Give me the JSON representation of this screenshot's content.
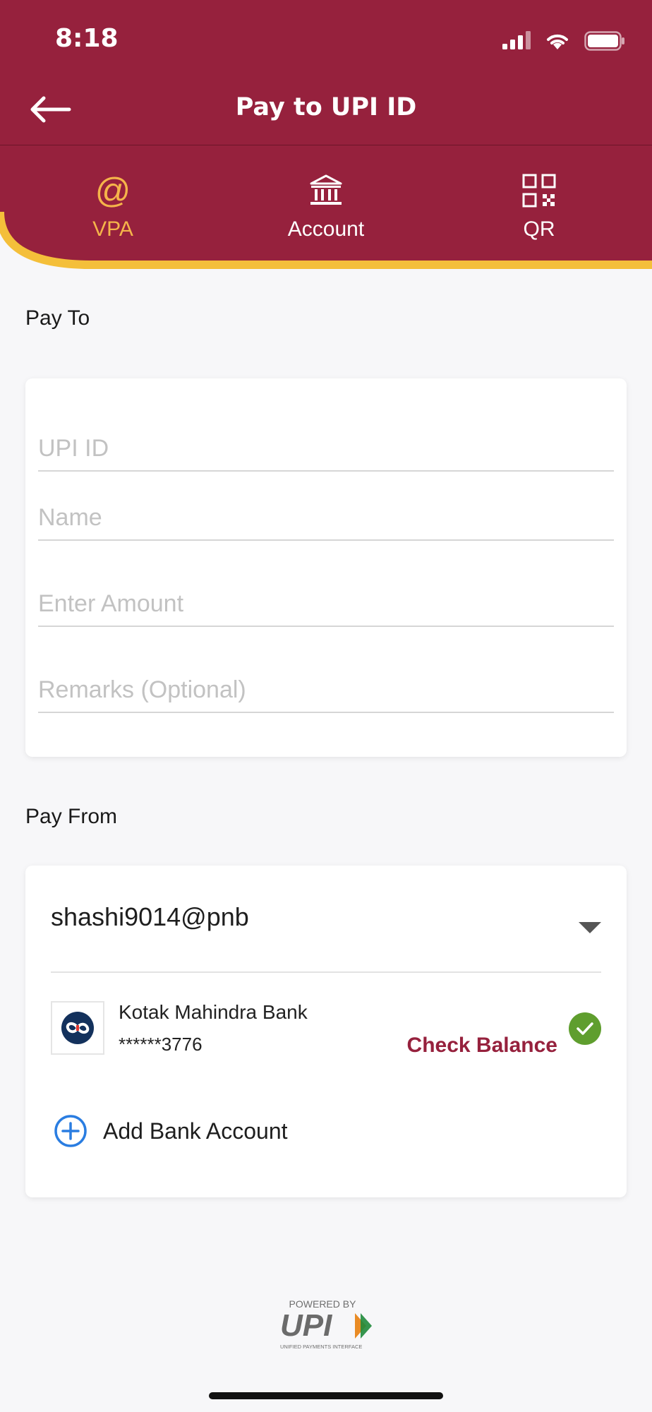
{
  "status_bar": {
    "time": "8:18"
  },
  "nav": {
    "title": "Pay to UPI ID"
  },
  "tabs": [
    {
      "label": "VPA",
      "icon": "at-icon",
      "active": true
    },
    {
      "label": "Account",
      "icon": "bank-icon",
      "active": false
    },
    {
      "label": "QR",
      "icon": "qr-icon",
      "active": false
    }
  ],
  "pay_to": {
    "title": "Pay To",
    "upi_id": {
      "value": "",
      "placeholder": "UPI ID"
    },
    "name": {
      "value": "",
      "placeholder": "Name"
    },
    "amount": {
      "value": "",
      "placeholder": "Enter Amount"
    },
    "remarks": {
      "value": "",
      "placeholder": "Remarks (Optional)"
    }
  },
  "pay_from": {
    "title": "Pay From",
    "vpa": "shashi9014@pnb",
    "bank": {
      "name": "Kotak Mahindra Bank",
      "account": "******3776"
    },
    "check_balance_label": "Check Balance",
    "add_bank_label": "Add Bank Account"
  },
  "footer": {
    "powered_by": "POWERED BY",
    "brand": "UPI",
    "tagline": "UNIFIED PAYMENTS INTERFACE"
  },
  "colors": {
    "primary": "#96213d",
    "accent": "#f5b44a",
    "verified": "#5f9e2e",
    "link": "#2a7de1"
  }
}
